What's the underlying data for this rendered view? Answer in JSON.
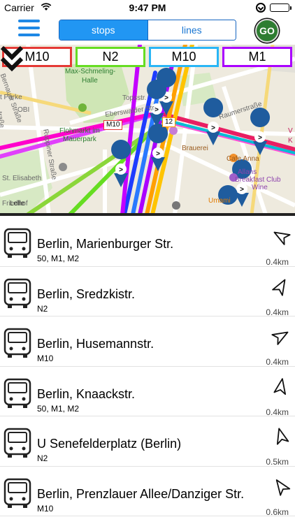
{
  "status_bar": {
    "carrier": "Carrier",
    "time": "9:47 PM"
  },
  "header": {
    "tabs": [
      {
        "label": "stops",
        "active": true
      },
      {
        "label": "lines",
        "active": false
      }
    ],
    "go_label": "GO"
  },
  "map": {
    "line_filters": [
      {
        "label": "M10",
        "color": "#e53935"
      },
      {
        "label": "N2",
        "color": "#66dd22"
      },
      {
        "label": "M10",
        "color": "#29b6f6"
      },
      {
        "label": "M1",
        "color": "#aa00ff"
      }
    ],
    "badges": [
      {
        "label": "M10"
      },
      {
        "label": "12"
      }
    ],
    "labels": {
      "schmeling": "Max-Schmeling-",
      "halle": "Halle",
      "flohmarkt": "Flohmarkt im",
      "mauerpark": "Mauerpark",
      "topsstr": "Topsstr.",
      "eberswalder": "Eberswalder Str.",
      "raumer": "Raumerstraße",
      "brauerei": "Brauerei",
      "cafe_anna": "Cafe Anna",
      "allans": "Allans",
      "breakfast": "Breakfast Club",
      "wine": "Wine",
      "umami": "Umami",
      "obi": "OBI",
      "elisabeth": "St. Elisabeth",
      "friedhof": "Friedhof",
      "lelle": "Lelle",
      "bernauer": "Bernauer Straße",
      "ruppiner": "Ruppiner Straße",
      "strasse": "traße",
      "tparke": "t Parke",
      "v": "V",
      "k": "K"
    }
  },
  "stops": [
    {
      "name": "Berlin, Marienburger Str.",
      "lines": "50, M1, M2",
      "distance": "0.4km",
      "bearing": -60
    },
    {
      "name": "Berlin, Sredzkistr.",
      "lines": "N2",
      "distance": "0.4km",
      "bearing": 30
    },
    {
      "name": "Berlin, Husemannstr.",
      "lines": "M10",
      "distance": "0.4km",
      "bearing": 60
    },
    {
      "name": "Berlin, Knaackstr.",
      "lines": "50, M1, M2",
      "distance": "0.4km",
      "bearing": 10
    },
    {
      "name": "U Senefelderplatz (Berlin)",
      "lines": "N2",
      "distance": "0.5km",
      "bearing": -15
    },
    {
      "name": "Berlin, Prenzlauer Allee/Danziger Str.",
      "lines": "M10",
      "distance": "0.6km",
      "bearing": -35
    }
  ]
}
